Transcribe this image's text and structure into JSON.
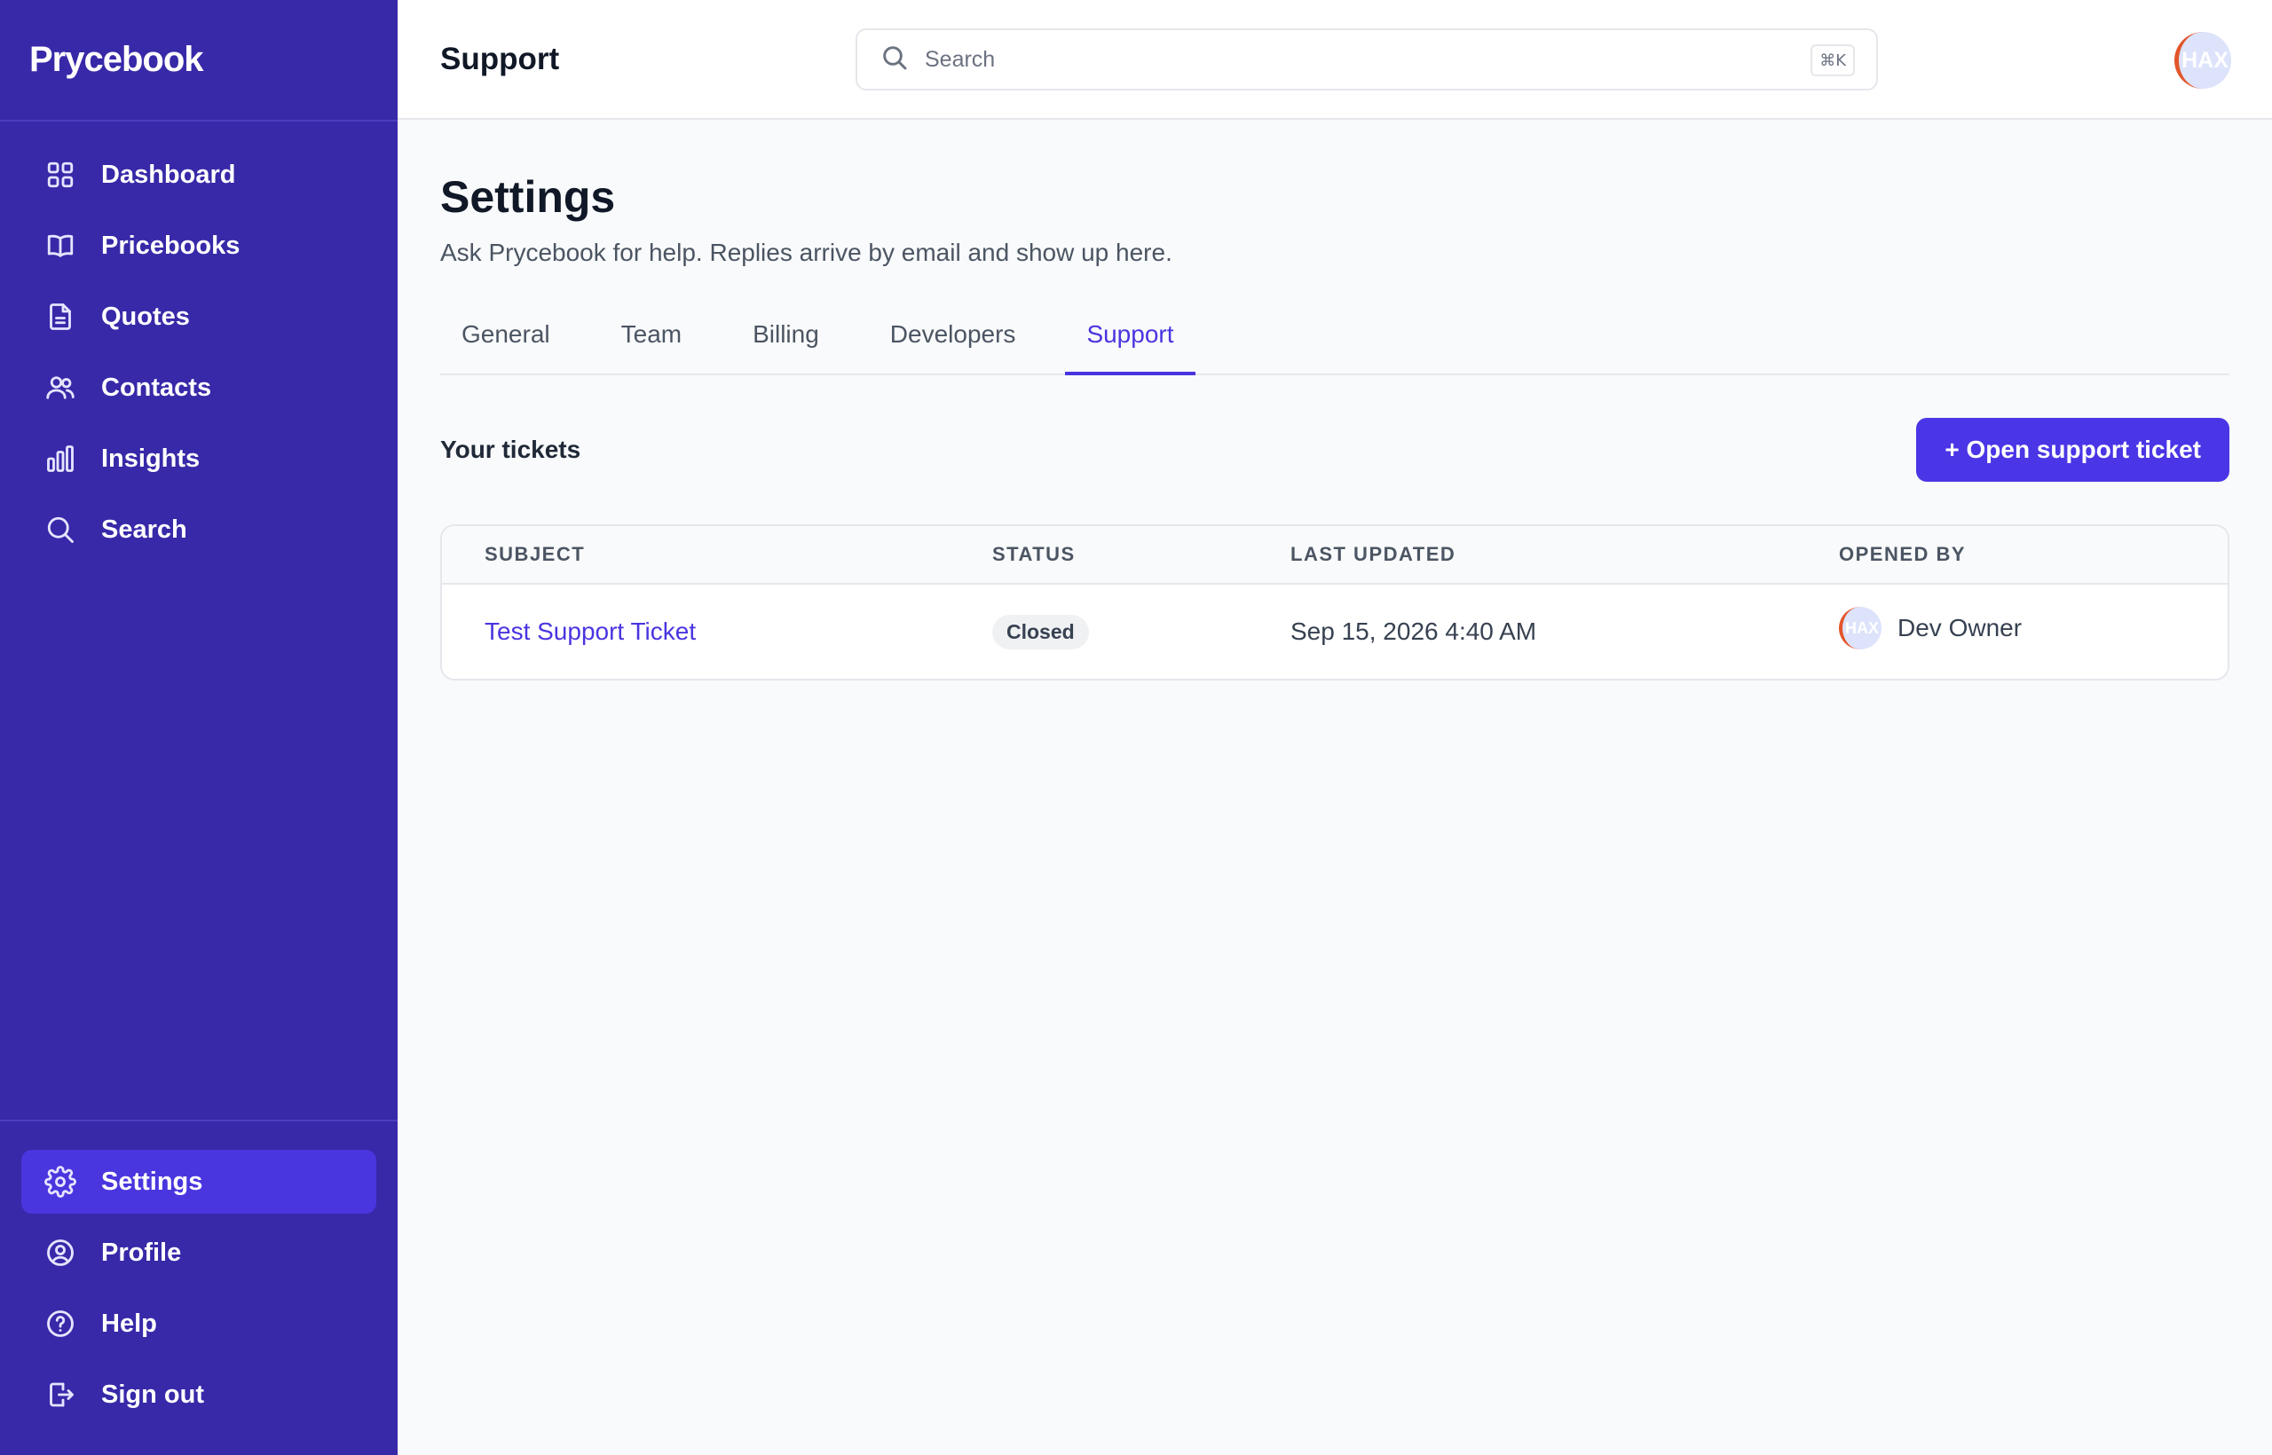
{
  "brand": "Prycebook",
  "sidebar": {
    "items": [
      {
        "label": "Dashboard",
        "icon": "dashboard-grid-icon"
      },
      {
        "label": "Pricebooks",
        "icon": "book-open-icon"
      },
      {
        "label": "Quotes",
        "icon": "document-icon"
      },
      {
        "label": "Contacts",
        "icon": "users-icon"
      },
      {
        "label": "Insights",
        "icon": "bar-chart-icon"
      },
      {
        "label": "Search",
        "icon": "search-icon"
      }
    ],
    "bottom_items": [
      {
        "label": "Settings",
        "icon": "gear-icon",
        "active": true
      },
      {
        "label": "Profile",
        "icon": "user-circle-icon"
      },
      {
        "label": "Help",
        "icon": "help-circle-icon"
      },
      {
        "label": "Sign out",
        "icon": "sign-out-icon"
      }
    ]
  },
  "topbar": {
    "title": "Support",
    "search_placeholder": "Search",
    "shortcut": "⌘K",
    "avatar_initials": "HAX"
  },
  "page": {
    "title": "Settings",
    "subtitle": "Ask Prycebook for help. Replies arrive by email and show up here."
  },
  "tabs": [
    {
      "label": "General",
      "active": false
    },
    {
      "label": "Team",
      "active": false
    },
    {
      "label": "Billing",
      "active": false
    },
    {
      "label": "Developers",
      "active": false
    },
    {
      "label": "Support",
      "active": true
    }
  ],
  "tickets": {
    "heading": "Your tickets",
    "open_button": "+ Open support ticket",
    "columns": [
      "SUBJECT",
      "STATUS",
      "LAST UPDATED",
      "OPENED BY"
    ],
    "rows": [
      {
        "subject": "Test Support Ticket",
        "status": "Closed",
        "last_updated": "Sep 15, 2026 4:40 AM",
        "opened_by": "Dev Owner",
        "opened_by_initials": "HAX"
      }
    ]
  },
  "colors": {
    "sidebar_bg": "#3729a8",
    "accent": "#4a36e6",
    "active_nav_bg": "#4a36de"
  }
}
